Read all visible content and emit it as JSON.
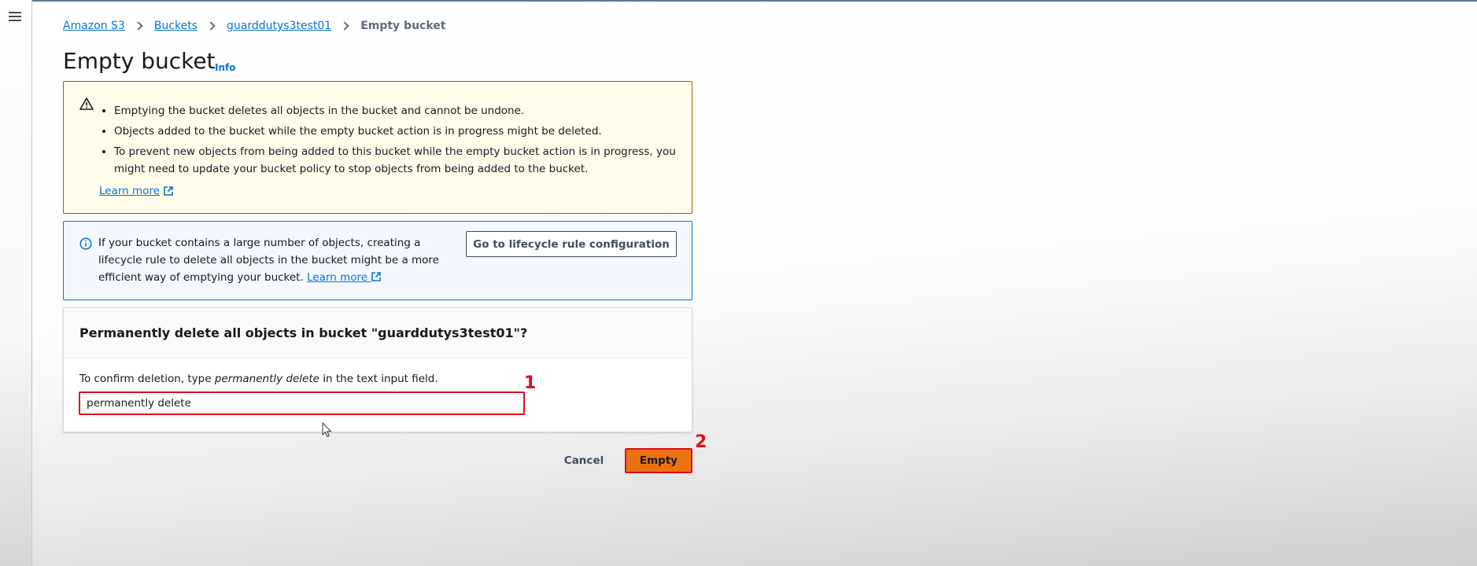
{
  "breadcrumb": {
    "items": [
      "Amazon S3",
      "Buckets",
      "guarddutys3test01"
    ],
    "current": "Empty bucket"
  },
  "page": {
    "title": "Empty bucket",
    "info_label": "Info"
  },
  "warning": {
    "icon": "warning-triangle-icon",
    "bullets": [
      "Emptying the bucket deletes all objects in the bucket and cannot be undone.",
      "Objects added to the bucket while the empty bucket action is in progress might be deleted.",
      "To prevent new objects from being added to this bucket while the empty bucket action is in progress, you might need to update your bucket policy to stop objects from being added to the bucket."
    ],
    "learn_more": "Learn more"
  },
  "info_alert": {
    "icon": "info-circle-icon",
    "text": "If your bucket contains a large number of objects, creating a lifecycle rule to delete all objects in the bucket might be a more efficient way of emptying your bucket.",
    "learn_more": "Learn more",
    "button_label": "Go to lifecycle rule configuration"
  },
  "confirm": {
    "heading": "Permanently delete all objects in bucket \"guarddutys3test01\"?",
    "instruction_prefix": "To confirm deletion, type",
    "instruction_phrase": "permanently delete",
    "instruction_suffix": "in the text input field.",
    "input_value": "permanently delete"
  },
  "actions": {
    "cancel_label": "Cancel",
    "empty_label": "Empty"
  },
  "annotations": {
    "step1": "1",
    "step2": "2"
  },
  "colors": {
    "link": "#0972d3",
    "primary_button": "#ec7211",
    "annotation": "#e0101c",
    "warning_bg": "#fffce9",
    "info_bg": "#f2f8fd"
  }
}
